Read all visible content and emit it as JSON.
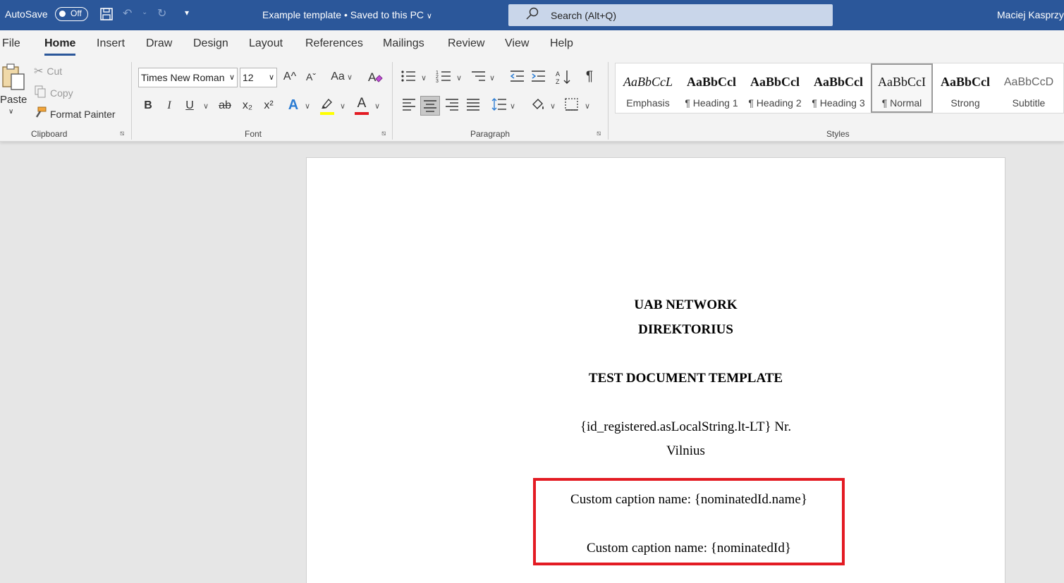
{
  "titlebar": {
    "autosave_label": "AutoSave",
    "autosave_state": "Off",
    "doc_title": "Example template • Saved to this PC",
    "search_placeholder": "Search (Alt+Q)",
    "user_name": "Maciej Kasprzy",
    "icons": [
      "save-icon",
      "undo-icon",
      "redo-icon",
      "customize-quick-access-icon",
      "search-icon"
    ]
  },
  "tabs": [
    "File",
    "Home",
    "Insert",
    "Draw",
    "Design",
    "Layout",
    "References",
    "Mailings",
    "Review",
    "View",
    "Help"
  ],
  "active_tab": "Home",
  "clipboard": {
    "paste_label": "Paste",
    "cut_label": "Cut",
    "copy_label": "Copy",
    "format_painter_label": "Format Painter",
    "group_label": "Clipboard"
  },
  "font": {
    "family": "Times New Roman",
    "size": "12",
    "group_label": "Font",
    "bold_glyph": "B",
    "italic_glyph": "I",
    "underline_glyph": "U",
    "strike_glyph": "ab",
    "subscript_glyph": "x₂",
    "superscript_glyph": "x²",
    "grow_glyph": "A^",
    "shrink_glyph": "Aˇ",
    "case_glyph": "Aa",
    "effects_glyph": "A",
    "font_color_glyph": "A",
    "highlight_color": "#ffff00",
    "font_color": "#e31b23"
  },
  "paragraph": {
    "group_label": "Paragraph",
    "pilcrow_glyph": "¶"
  },
  "styles": {
    "group_label": "Styles",
    "items": [
      {
        "preview": "AaBbCcL",
        "name": "Emphasis"
      },
      {
        "preview": "AaBbCcl",
        "name": "¶ Heading 1"
      },
      {
        "preview": "AaBbCcl",
        "name": "¶ Heading 2"
      },
      {
        "preview": "AaBbCcl",
        "name": "¶ Heading 3"
      },
      {
        "preview": "AaBbCcI",
        "name": "¶ Normal"
      },
      {
        "preview": "AaBbCcl",
        "name": "Strong"
      },
      {
        "preview": "AaBbCcD",
        "name": "Subtitle"
      }
    ],
    "selected": "¶ Normal"
  },
  "document": {
    "org": "UAB  NETWORK",
    "role": "DIREKTORIUS",
    "heading": "TEST DOCUMENT TEMPLATE",
    "reg_line": "{id_registered.asLocalString.lt-LT} Nr.",
    "city": "Vilnius",
    "caption_1": "Custom caption name: {nominatedId.name}",
    "caption_2": "Custom caption name: {nominatedId}",
    "highlight_box_color": "#e31b23"
  },
  "colors": {
    "title_bar": "#2b579a",
    "ribbon": "#f3f3f3",
    "canvas": "#e6e6e6"
  }
}
